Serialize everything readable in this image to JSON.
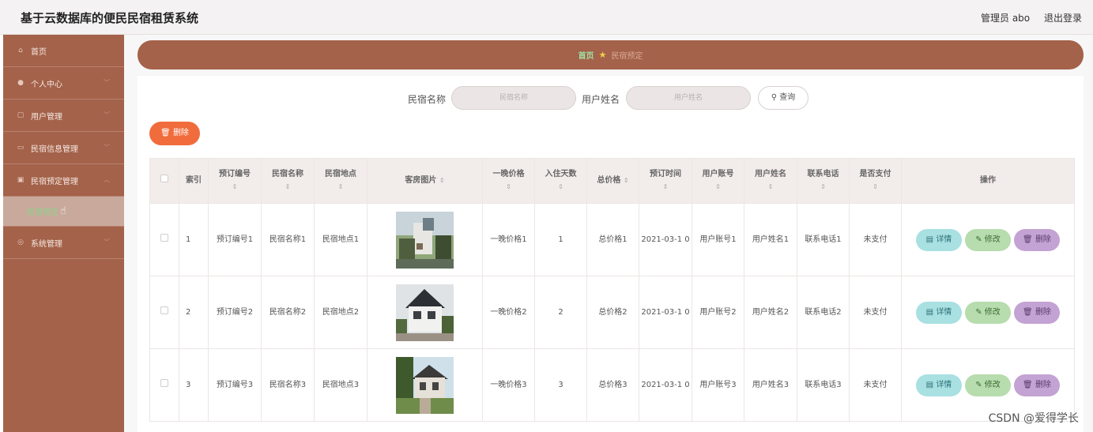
{
  "header": {
    "title": "基于云数据库的便民民宿租赁系统",
    "admin_label": "管理员 abo",
    "logout_label": "退出登录"
  },
  "sidebar": {
    "items": [
      {
        "label": "首页",
        "icon": "home-icon"
      },
      {
        "label": "个人中心",
        "icon": "user-icon"
      },
      {
        "label": "用户管理",
        "icon": "users-icon"
      },
      {
        "label": "民宿信息管理",
        "icon": "list-icon"
      },
      {
        "label": "民宿预定管理",
        "icon": "booking-icon"
      },
      {
        "label": "系统管理",
        "icon": "settings-icon"
      }
    ],
    "active_sub": "民宿预定"
  },
  "breadcrumb": {
    "home": "首页",
    "current": "民宿预定"
  },
  "search": {
    "name_label": "民宿名称",
    "name_placeholder": "民宿名称",
    "user_label": "用户姓名",
    "user_placeholder": "用户姓名",
    "button": "查询"
  },
  "toolbar": {
    "delete_label": "删除"
  },
  "table": {
    "headers": [
      "索引",
      "预订编号",
      "民宿名称",
      "民宿地点",
      "客房图片",
      "一晚价格",
      "入住天数",
      "总价格",
      "预订时间",
      "用户账号",
      "用户姓名",
      "联系电话",
      "是否支付",
      "操作"
    ],
    "rows": [
      {
        "index": "1",
        "order_no": "预订编号1",
        "name": "民宿名称1",
        "location": "民宿地点1",
        "price": "一晚价格1",
        "days": "1",
        "total": "总价格1",
        "time": "2021-03-1 0",
        "account": "用户账号1",
        "user": "用户姓名1",
        "phone": "联系电话1",
        "paid": "未支付"
      },
      {
        "index": "2",
        "order_no": "预订编号2",
        "name": "民宿名称2",
        "location": "民宿地点2",
        "price": "一晚价格2",
        "days": "2",
        "total": "总价格2",
        "time": "2021-03-1 0",
        "account": "用户账号2",
        "user": "用户姓名2",
        "phone": "联系电话2",
        "paid": "未支付"
      },
      {
        "index": "3",
        "order_no": "预订编号3",
        "name": "民宿名称3",
        "location": "民宿地点3",
        "price": "一晚价格3",
        "days": "3",
        "total": "总价格3",
        "time": "2021-03-1 0",
        "account": "用户账号3",
        "user": "用户姓名3",
        "phone": "联系电话3",
        "paid": "未支付"
      }
    ],
    "actions": {
      "detail": "详情",
      "edit": "修改",
      "delete": "删除"
    }
  },
  "watermark": "CSDN @爱得学长",
  "colors": {
    "sidebar": "#a4624a",
    "accent_delete": "#f16c3c",
    "detail": "#a9e0e2",
    "edit": "#b7dcae",
    "remove": "#c3a3d3"
  }
}
